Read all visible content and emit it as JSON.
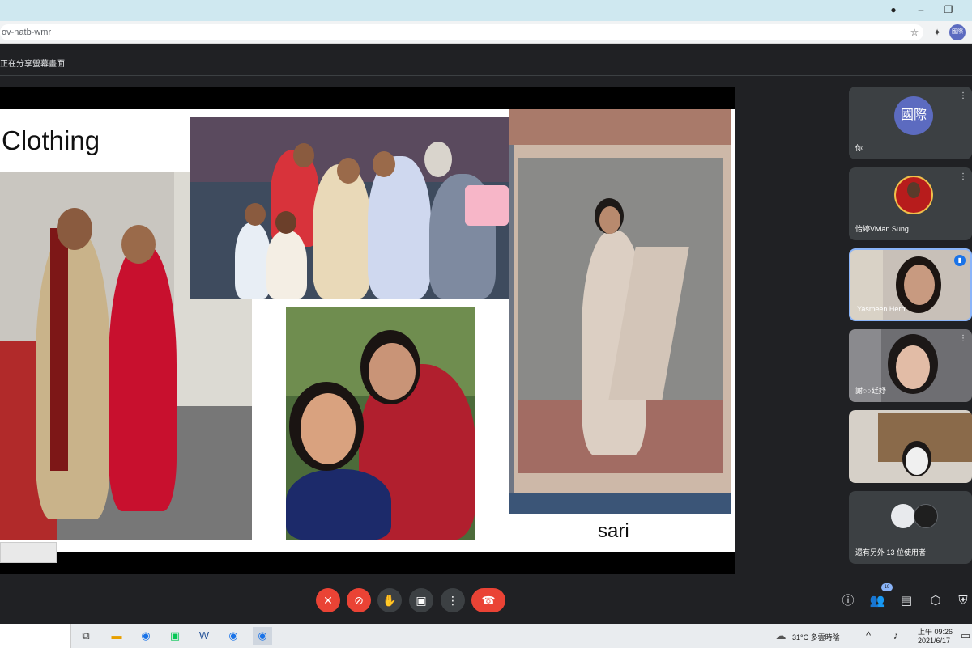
{
  "browser": {
    "url": "ov-natb-wmr",
    "profile_initials": "國際",
    "minimize_label": "–",
    "restore_label": "❐"
  },
  "meet": {
    "presenting_text": "正在分享螢幕畫面"
  },
  "slide": {
    "title": "Clothing",
    "caption": "sari"
  },
  "participants": [
    {
      "name": "你",
      "avatar_text": "國際",
      "avatar_color": "#5c6bc0"
    },
    {
      "name": "怡婷Vivian Sung"
    },
    {
      "name": "Yasmeen Herb"
    },
    {
      "name": "謝○○廷妤"
    },
    {
      "name": ""
    },
    {
      "name": "還有另外 13 位使用者"
    }
  ],
  "controls": {
    "mic": "mic-off-icon",
    "camera": "camera-off-icon",
    "raise_hand": "hand-icon",
    "present": "present-icon",
    "more": "more-icon",
    "hangup": "hangup-icon",
    "people_count": "19"
  },
  "taskbar": {
    "weather": "31°C 多雲時陰",
    "time": "上午 09:26",
    "date": "2021/6/17"
  },
  "colors": {
    "accent_red": "#ea4335",
    "meet_bg": "#202124",
    "tile_bg": "#3c4043"
  }
}
